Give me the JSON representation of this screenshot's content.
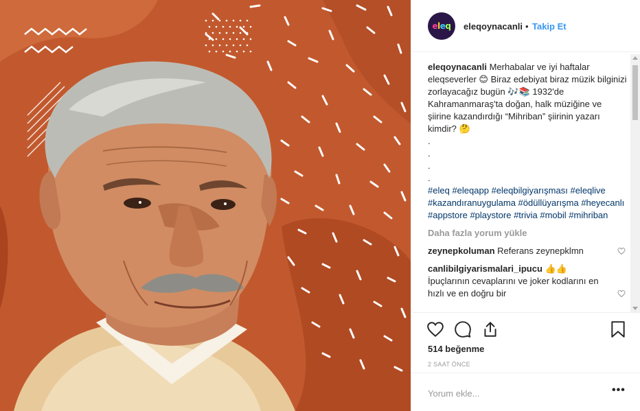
{
  "post": {
    "username": "eleqoynacanli",
    "separator": "•",
    "follow_label": "Takip Et",
    "avatar_text": [
      "e",
      "l",
      "e",
      "q"
    ],
    "avatar_colors": [
      "#ff3f8e",
      "#ffd23c",
      "#3fd0ff",
      "#9cff5a"
    ],
    "image_alt_icon": "portrait-illustration",
    "colors": {
      "image_bg": "#c2592e",
      "link": "#3897f0",
      "hashtag": "#003569",
      "muted": "#999999"
    }
  },
  "caption": {
    "username": "eleqoynacanli",
    "text": "Merhabalar ve iyi haftalar eleqseverler 😊 Biraz edebiyat biraz müzik bilginizi zorlayacağız bugün 🎶📚 1932'de Kahramanmaraş'ta doğan, halk müziğine ve şiirine kazandırdığı “Mihriban” şiirinin yazarı kimdir? 🤔",
    "dots": [
      ".",
      ".",
      ".",
      "."
    ],
    "hashtags": [
      "#eleq",
      "#eleqapp",
      "#eleqbilgiyarışması",
      "#eleqlive",
      "#kazandıranuygulama",
      "#ödüllüyarışma",
      "#heyecanlı",
      "#appstore",
      "#playstore",
      "#trivia",
      "#mobil",
      "#mihriban"
    ]
  },
  "comments": {
    "load_more_label": "Daha fazla yorum yükle",
    "items": [
      {
        "user": "zeynepkoluman",
        "text": "Referans zeynepklmn"
      },
      {
        "user": "canlibilgiyarismalari_ipucu",
        "text": "👍👍 İpuçlarının cevaplarını ve joker kodlarını en hızlı ve en doğru bir"
      }
    ]
  },
  "actions": {
    "likes_label": "514 beğenme",
    "time_label": "2 SAAT ÖNCE",
    "comment_placeholder": "Yorum ekle...",
    "more_label": "•••"
  }
}
